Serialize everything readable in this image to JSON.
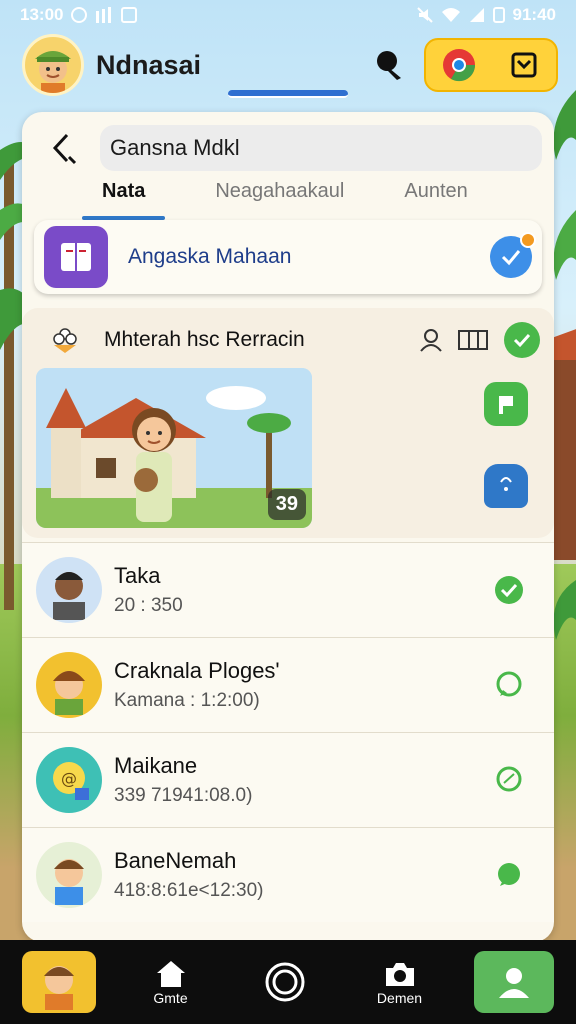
{
  "status_bar": {
    "time_left": "13:00",
    "time_right": "91:40"
  },
  "header": {
    "title": "Ndnasai"
  },
  "search": {
    "value": "Gansna Mdkl"
  },
  "tabs": [
    {
      "label": "Nata",
      "active": true
    },
    {
      "label": "Neagahaakaul",
      "active": false
    },
    {
      "label": "Aunten",
      "active": false
    }
  ],
  "featured": {
    "label": "Angaska Mahaan"
  },
  "card": {
    "title": "Mhterah hsc Rerracin",
    "image_count": "39"
  },
  "list": [
    {
      "name": "Taka",
      "sub": "20 : 350",
      "status_icon": "check-circle-icon"
    },
    {
      "name": "Craknala Ploges'",
      "sub": "Kamana : 1:2:00)",
      "status_icon": "chat-bubble-icon"
    },
    {
      "name": "Maikane",
      "sub": "339 71941:08.0)",
      "status_icon": "leaf-bubble-icon"
    },
    {
      "name": "BaneNemah",
      "sub": "418:8:61e<12:30)",
      "status_icon": "chat-bubble-icon"
    }
  ],
  "bottom_nav": [
    {
      "label": "",
      "icon": "avatar"
    },
    {
      "label": "Gmte",
      "icon": "home-icon"
    },
    {
      "label": "",
      "icon": "record-icon"
    },
    {
      "label": "Demen",
      "icon": "camera-icon"
    },
    {
      "label": "",
      "icon": "profile-icon"
    }
  ],
  "colors": {
    "accent_blue": "#2f78c8",
    "yellow": "#ffd23a",
    "green": "#49b84a",
    "purple": "#7a4bc8"
  }
}
